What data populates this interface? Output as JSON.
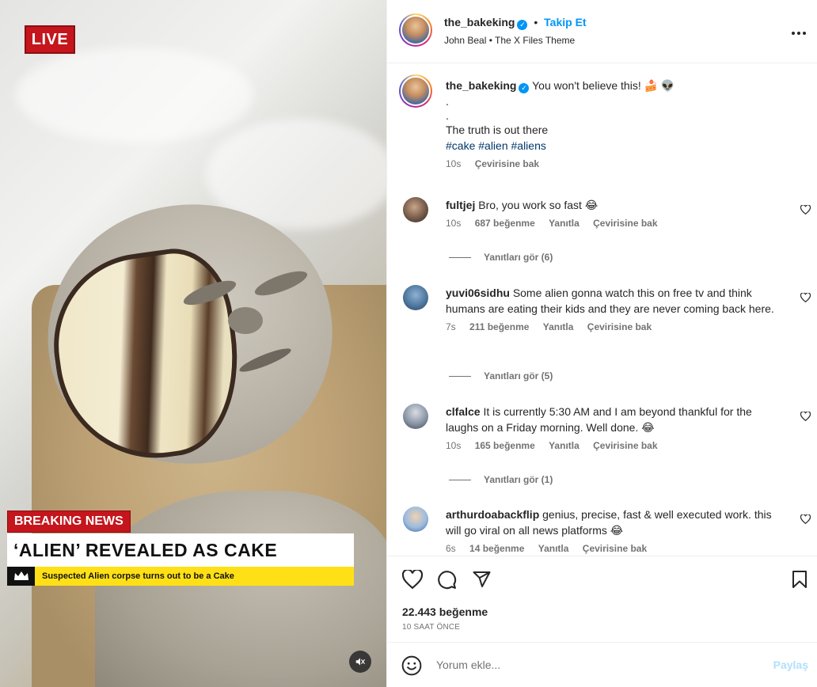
{
  "media": {
    "live_label": "LIVE",
    "breaking_label": "BREAKING NEWS",
    "headline": "‘ALIEN’ REVEALED AS CAKE",
    "ticker": "Suspected Alien corpse turns out to be a Cake",
    "ticker_icon": "crown-icon",
    "mute_icon": "speaker-muted-icon"
  },
  "header": {
    "username": "the_bakeking",
    "separator": "•",
    "follow_label": "Takip Et",
    "audio": "John Beal • The X Files Theme",
    "more_label": "•••"
  },
  "caption": {
    "username": "the_bakeking",
    "text": "You won't believe this! 🍰 👽",
    "line2": ".",
    "line3": ".",
    "line4": "The truth is out there",
    "hashtags": "#cake #alien #aliens",
    "time": "10s",
    "translate": "Çevirisine bak"
  },
  "comments": [
    {
      "username": "fultjej",
      "text": "Bro, you work so fast 😂",
      "time": "10s",
      "likes": "687 beğenme",
      "reply": "Yanıtla",
      "translate": "Çevirisine bak",
      "replies": "Yanıtları gör (6)"
    },
    {
      "username": "yuvi06sidhu",
      "text": "Some alien gonna watch this on free tv and think humans are eating their kids and they are never coming back here.",
      "time": "7s",
      "likes": "211 beğenme",
      "reply": "Yanıtla",
      "translate": "Çevirisine bak",
      "replies": "Yanıtları gör (5)"
    },
    {
      "username": "clfalce",
      "text": "It is currently 5:30 AM and I am beyond thankful for the laughs on a Friday morning. Well done. 😂",
      "time": "10s",
      "likes": "165 beğenme",
      "reply": "Yanıtla",
      "translate": "Çevirisine bak",
      "replies": "Yanıtları gör (1)"
    },
    {
      "username": "arthurdoabackflip",
      "text": "genius, precise, fast & well executed work. this will go viral on all news platforms 😂",
      "time": "6s",
      "likes": "14 beğenme",
      "reply": "Yanıtla",
      "translate": "Çevirisine bak"
    }
  ],
  "actions": {
    "likes": "22.443 beğenme",
    "ago": "10 SAAT ÖNCE"
  },
  "add_comment": {
    "placeholder": "Yorum ekle...",
    "share_label": "Paylaş"
  }
}
